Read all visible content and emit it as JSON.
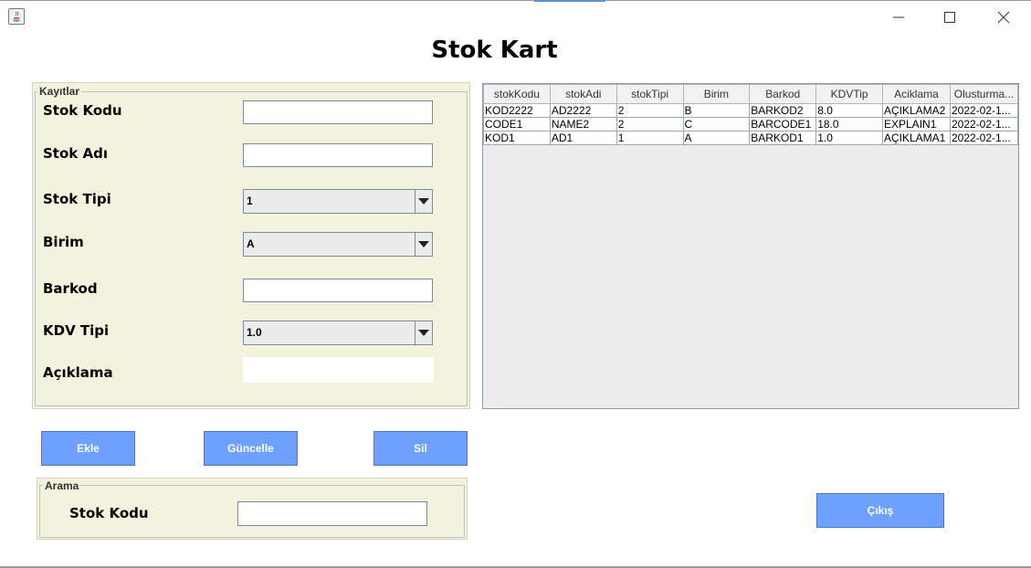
{
  "window": {
    "title": "Stok Kart",
    "controls": {
      "minimize": "minimize-icon",
      "maximize": "maximize-icon",
      "close": "close-icon"
    }
  },
  "records_panel": {
    "legend": "Kayıtlar",
    "fields": {
      "stok_kodu": {
        "label": "Stok Kodu",
        "value": ""
      },
      "stok_adi": {
        "label": "Stok Adı",
        "value": ""
      },
      "stok_tipi": {
        "label": "Stok Tipi",
        "selected": "1"
      },
      "birim": {
        "label": "Birim",
        "selected": "A"
      },
      "barkod": {
        "label": "Barkod",
        "value": ""
      },
      "kdv_tipi": {
        "label": "KDV Tipi",
        "selected": "1.0"
      },
      "aciklama": {
        "label": "Açıklama",
        "value": ""
      }
    }
  },
  "actions": {
    "add": "Ekle",
    "update": "Güncelle",
    "delete": "Sil",
    "exit": "Çıkış"
  },
  "search_panel": {
    "legend": "Arama",
    "label": "Stok Kodu",
    "value": ""
  },
  "table": {
    "columns": [
      "stokKodu",
      "stokAdi",
      "stokTipi",
      "Birim",
      "Barkod",
      "KDVTip",
      "Aciklama",
      "Olusturma..."
    ],
    "rows": [
      [
        "KOD2222",
        "AD2222",
        "2",
        "B",
        "BARKOD2",
        "8.0",
        "AÇIKLAMA2",
        "2022-02-1..."
      ],
      [
        "CODE1",
        "NAME2",
        "2",
        "C",
        "BARCODE1",
        "18.0",
        "EXPLAIN1",
        "2022-02-1..."
      ],
      [
        "KOD1",
        "AD1",
        "1",
        "A",
        "BARKOD1",
        "1.0",
        "AÇIKLAMA1",
        "2022-02-1..."
      ]
    ]
  },
  "colors": {
    "panel_bg": "#f3f3dd",
    "button_bg": "#6ea0ff",
    "table_bg": "#ededed"
  }
}
